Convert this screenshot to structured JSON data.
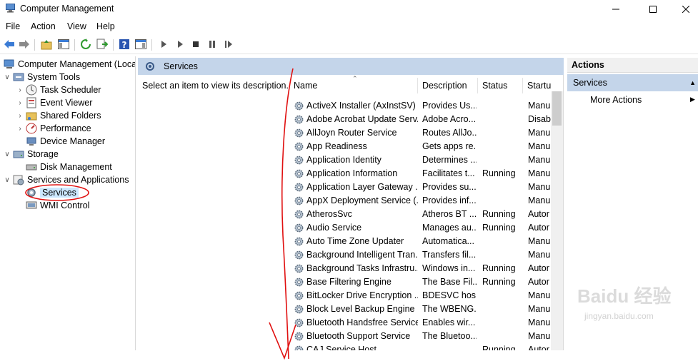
{
  "window": {
    "title": "Computer Management"
  },
  "menu": [
    "File",
    "Action",
    "View",
    "Help"
  ],
  "tree": {
    "items": [
      {
        "label": "Computer Management (Local",
        "level": 0,
        "expanded": null
      },
      {
        "label": "System Tools",
        "level": 1,
        "expanded": true
      },
      {
        "label": "Task Scheduler",
        "level": 2,
        "expanded": false
      },
      {
        "label": "Event Viewer",
        "level": 2,
        "expanded": false
      },
      {
        "label": "Shared Folders",
        "level": 2,
        "expanded": false
      },
      {
        "label": "Performance",
        "level": 2,
        "expanded": false
      },
      {
        "label": "Device Manager",
        "level": 2,
        "expanded": null
      },
      {
        "label": "Storage",
        "level": 1,
        "expanded": true
      },
      {
        "label": "Disk Management",
        "level": 2,
        "expanded": null
      },
      {
        "label": "Services and Applications",
        "level": 1,
        "expanded": true
      },
      {
        "label": "Services",
        "level": 2,
        "expanded": null,
        "selected": true
      },
      {
        "label": "WMI Control",
        "level": 2,
        "expanded": null
      }
    ]
  },
  "center": {
    "header": "Services",
    "description_hint": "Select an item to view its description.",
    "columns": [
      "Name",
      "Description",
      "Status",
      "Startu"
    ],
    "rows": [
      {
        "name": "ActiveX Installer (AxInstSV)",
        "description": "Provides Us...",
        "status": "",
        "startup": "Manu"
      },
      {
        "name": "Adobe Acrobat Update Serv...",
        "description": "Adobe Acro...",
        "status": "",
        "startup": "Disabl"
      },
      {
        "name": "AllJoyn Router Service",
        "description": "Routes AllJo...",
        "status": "",
        "startup": "Manu"
      },
      {
        "name": "App Readiness",
        "description": "Gets apps re...",
        "status": "",
        "startup": "Manu"
      },
      {
        "name": "Application Identity",
        "description": "Determines ...",
        "status": "",
        "startup": "Manu"
      },
      {
        "name": "Application Information",
        "description": "Facilitates t...",
        "status": "Running",
        "startup": "Manu"
      },
      {
        "name": "Application Layer Gateway ...",
        "description": "Provides su...",
        "status": "",
        "startup": "Manu"
      },
      {
        "name": "AppX Deployment Service (...",
        "description": "Provides inf...",
        "status": "",
        "startup": "Manu"
      },
      {
        "name": "AtherosSvc",
        "description": "Atheros BT ...",
        "status": "Running",
        "startup": "Autor"
      },
      {
        "name": "Audio Service",
        "description": "Manages au...",
        "status": "Running",
        "startup": "Autor"
      },
      {
        "name": "Auto Time Zone Updater",
        "description": "Automatica...",
        "status": "",
        "startup": "Manu"
      },
      {
        "name": "Background Intelligent Tran...",
        "description": "Transfers fil...",
        "status": "",
        "startup": "Manu"
      },
      {
        "name": "Background Tasks Infrastru...",
        "description": "Windows in...",
        "status": "Running",
        "startup": "Autor"
      },
      {
        "name": "Base Filtering Engine",
        "description": "The Base Fil...",
        "status": "Running",
        "startup": "Autor"
      },
      {
        "name": "BitLocker Drive Encryption ...",
        "description": "BDESVC hos...",
        "status": "",
        "startup": "Manu"
      },
      {
        "name": "Block Level Backup Engine ...",
        "description": "The WBENG...",
        "status": "",
        "startup": "Manu"
      },
      {
        "name": "Bluetooth Handsfree Service",
        "description": "Enables wir...",
        "status": "",
        "startup": "Manu"
      },
      {
        "name": "Bluetooth Support Service",
        "description": "The Bluetoo...",
        "status": "",
        "startup": "Manu"
      },
      {
        "name": "CAJ Service Host",
        "description": "",
        "status": "Running",
        "startup": "Autor"
      }
    ]
  },
  "actions": {
    "title": "Actions",
    "section": "Services",
    "more": "More Actions"
  },
  "colors": {
    "header_blue": "#c4d5ea",
    "selection": "#cce8ff",
    "annotation_red": "#e01010"
  }
}
